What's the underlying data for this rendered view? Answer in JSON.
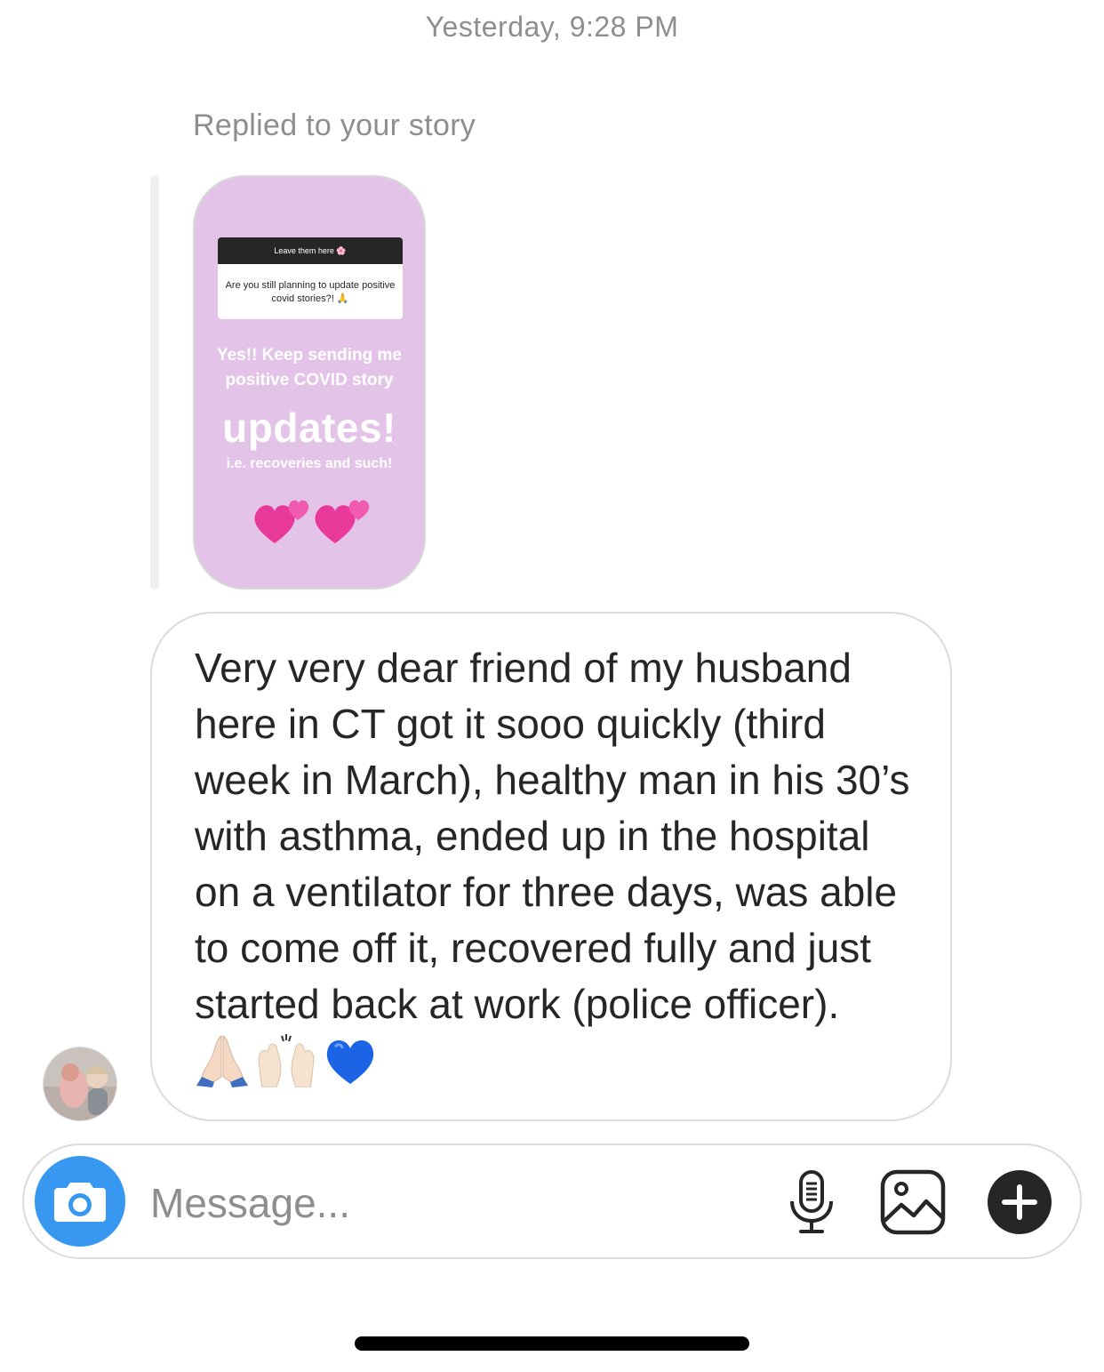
{
  "thread": {
    "timestamp": "Yesterday, 9:28 PM",
    "reply_label": "Replied to your story"
  },
  "story": {
    "question_header": "Leave them here 🌸",
    "question_text": "Are you still planning to update positive covid stories?! 🙏",
    "line1": "Yes!! Keep sending me",
    "line2": "positive COVID story",
    "line3": "updates!",
    "line4": "i.e. recoveries and such!",
    "background_color": "#e3c3e8",
    "hearts_icon": "two-hearts-icon"
  },
  "message": {
    "text": "Very very dear friend of my husband here in CT got it sooo quickly (third week in March), healthy man in his 30’s with asthma, ended up in the hospital on a ventilator for three days, was able to come off it, recovered fully and just started back at work (police officer).",
    "emojis": [
      "folded-hands-icon",
      "raising-hands-icon",
      "blue-heart-icon"
    ]
  },
  "composer": {
    "placeholder": "Message...",
    "camera_icon": "camera-icon",
    "mic_icon": "microphone-icon",
    "gallery_icon": "gallery-icon",
    "plus_icon": "plus-circle-icon",
    "accent_color": "#3897f0"
  }
}
